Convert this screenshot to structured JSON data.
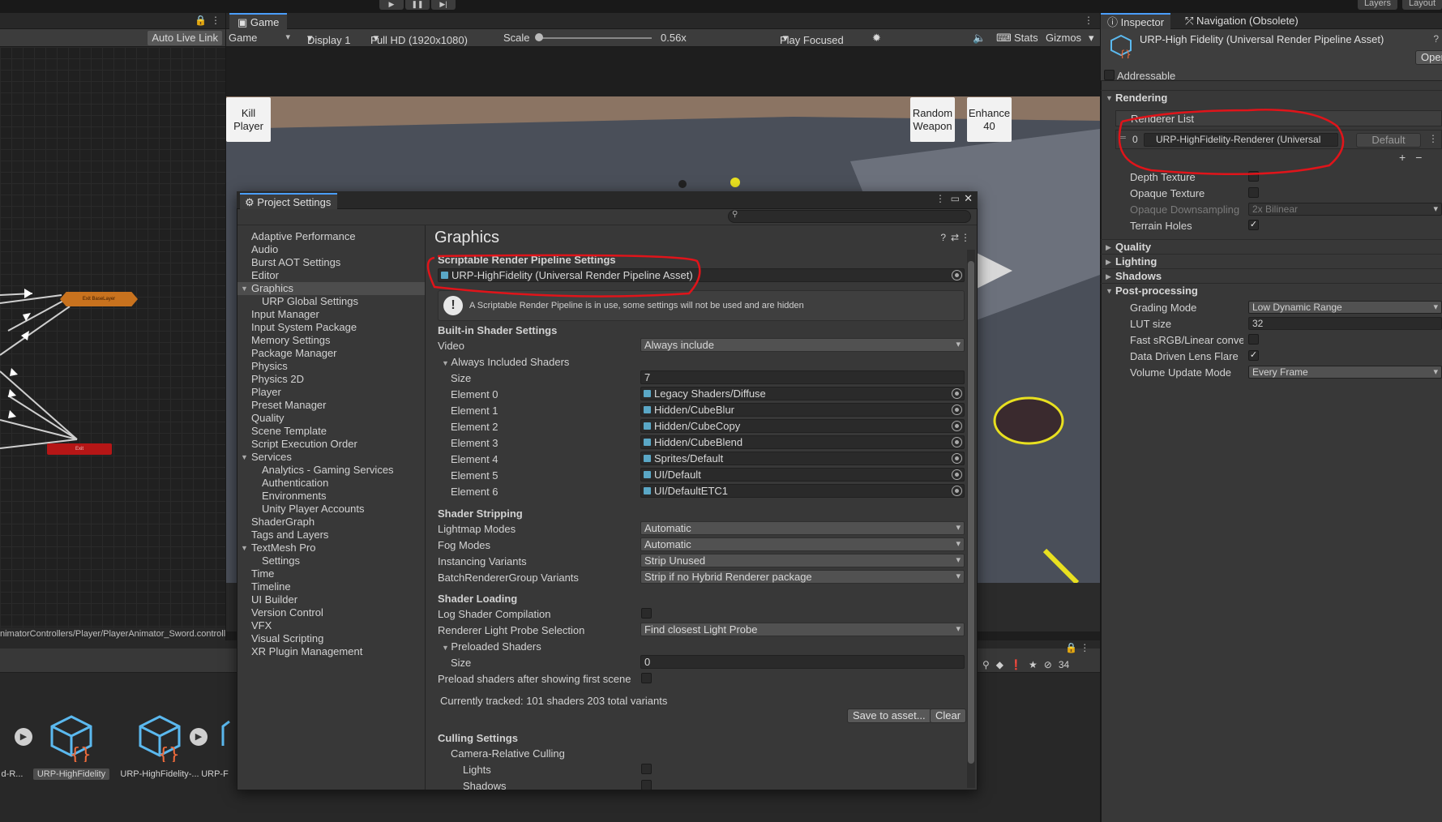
{
  "topbar": {
    "play_icons": [
      "▶",
      "❚❚",
      "▶|"
    ],
    "right": [
      "Layers",
      "Layout"
    ]
  },
  "animator": {
    "auto_live_link": "Auto Live Link",
    "state_base": "Exit BaseLayer",
    "state_exit": "Exit",
    "path": "nimatorControllers/Player/PlayerAnimator_Sword.controller"
  },
  "game": {
    "tab": "Game",
    "view_mode": "Game",
    "display": "Display 1",
    "resolution": "Full HD (1920x1080)",
    "scale_label": "Scale",
    "scale_value": "0.56x",
    "play_focused": "Play Focused",
    "stats": "Stats",
    "gizmos": "Gizmos",
    "btn_kill_player": "Kill Player",
    "btn_random_weapon": "Random Weapon",
    "btn_enhance": "Enhance 40",
    "hidden_count": "34"
  },
  "assets": [
    {
      "label": "d-R..."
    },
    {
      "label": "URP-HighFidelity"
    },
    {
      "label": "URP-HighFidelity-..."
    },
    {
      "label": "URP-F"
    }
  ],
  "inspector": {
    "tab_inspector": "Inspector",
    "tab_navigation": "Navigation (Obsolete)",
    "asset_title": "URP-High Fidelity (Universal Render Pipeline Asset)",
    "open_button": "Open",
    "addressable": "Addressable",
    "rendering": "Rendering",
    "renderer_list": "Renderer List",
    "renderer_index": "0",
    "renderer_value": "URP-HighFidelity-Renderer (Universal",
    "default_button": "Default",
    "depth_texture": "Depth Texture",
    "opaque_texture": "Opaque Texture",
    "opaque_downsampling": "Opaque Downsampling",
    "opaque_downsampling_value": "2x Bilinear",
    "terrain_holes": "Terrain Holes",
    "quality": "Quality",
    "lighting": "Lighting",
    "shadows": "Shadows",
    "post_processing": "Post-processing",
    "grading_mode": "Grading Mode",
    "grading_mode_value": "Low Dynamic Range",
    "lut_size": "LUT size",
    "lut_size_value": "32",
    "fast_srgb": "Fast sRGB/Linear convers",
    "data_driven_lens_flare": "Data Driven Lens Flare",
    "volume_update_mode": "Volume Update Mode",
    "volume_update_mode_value": "Every Frame"
  },
  "project_settings": {
    "window_title": "Project Settings",
    "sidebar": [
      {
        "label": "Adaptive Performance",
        "indent": 0
      },
      {
        "label": "Audio",
        "indent": 0
      },
      {
        "label": "Burst AOT Settings",
        "indent": 0
      },
      {
        "label": "Editor",
        "indent": 0
      },
      {
        "label": "Graphics",
        "indent": 0,
        "selected": true,
        "expanded": true
      },
      {
        "label": "URP Global Settings",
        "indent": 1
      },
      {
        "label": "Input Manager",
        "indent": 0
      },
      {
        "label": "Input System Package",
        "indent": 0
      },
      {
        "label": "Memory Settings",
        "indent": 0
      },
      {
        "label": "Package Manager",
        "indent": 0
      },
      {
        "label": "Physics",
        "indent": 0
      },
      {
        "label": "Physics 2D",
        "indent": 0
      },
      {
        "label": "Player",
        "indent": 0
      },
      {
        "label": "Preset Manager",
        "indent": 0
      },
      {
        "label": "Quality",
        "indent": 0
      },
      {
        "label": "Scene Template",
        "indent": 0
      },
      {
        "label": "Script Execution Order",
        "indent": 0
      },
      {
        "label": "Services",
        "indent": 0,
        "expanded": true
      },
      {
        "label": "Analytics - Gaming Services",
        "indent": 1
      },
      {
        "label": "Authentication",
        "indent": 1
      },
      {
        "label": "Environments",
        "indent": 1
      },
      {
        "label": "Unity Player Accounts",
        "indent": 1
      },
      {
        "label": "ShaderGraph",
        "indent": 0
      },
      {
        "label": "Tags and Layers",
        "indent": 0
      },
      {
        "label": "TextMesh Pro",
        "indent": 0,
        "expanded": true
      },
      {
        "label": "Settings",
        "indent": 1
      },
      {
        "label": "Time",
        "indent": 0
      },
      {
        "label": "Timeline",
        "indent": 0
      },
      {
        "label": "UI Builder",
        "indent": 0
      },
      {
        "label": "Version Control",
        "indent": 0
      },
      {
        "label": "VFX",
        "indent": 0
      },
      {
        "label": "Visual Scripting",
        "indent": 0
      },
      {
        "label": "XR Plugin Management",
        "indent": 0
      }
    ],
    "page_title": "Graphics",
    "srp_header": "Scriptable Render Pipeline Settings",
    "srp_value": "URP-HighFidelity (Universal Render Pipeline Asset)",
    "srp_info": "A Scriptable Render Pipeline is in use, some settings will not be used and are hidden",
    "builtin_header": "Built-in Shader Settings",
    "video_label": "Video",
    "video_value": "Always include",
    "always_included": "Always Included Shaders",
    "size_label": "Size",
    "size_value": "7",
    "elements": [
      {
        "label": "Element 0",
        "value": "Legacy Shaders/Diffuse"
      },
      {
        "label": "Element 1",
        "value": "Hidden/CubeBlur"
      },
      {
        "label": "Element 2",
        "value": "Hidden/CubeCopy"
      },
      {
        "label": "Element 3",
        "value": "Hidden/CubeBlend"
      },
      {
        "label": "Element 4",
        "value": "Sprites/Default"
      },
      {
        "label": "Element 5",
        "value": "UI/Default"
      },
      {
        "label": "Element 6",
        "value": "UI/DefaultETC1"
      }
    ],
    "stripping_header": "Shader Stripping",
    "lightmap_modes": "Lightmap Modes",
    "lightmap_modes_value": "Automatic",
    "fog_modes": "Fog Modes",
    "fog_modes_value": "Automatic",
    "instancing_variants": "Instancing Variants",
    "instancing_variants_value": "Strip Unused",
    "brg_variants": "BatchRendererGroup Variants",
    "brg_variants_value": "Strip if no Hybrid Renderer package",
    "loading_header": "Shader Loading",
    "log_shader_compilation": "Log Shader Compilation",
    "probe_selection": "Renderer Light Probe Selection",
    "probe_selection_value": "Find closest Light Probe",
    "preloaded_shaders": "Preloaded Shaders",
    "preloaded_size_label": "Size",
    "preloaded_size_value": "0",
    "preload_after": "Preload shaders after showing first scene",
    "tracked": "Currently tracked: 101 shaders 203 total variants",
    "save_to_asset": "Save to asset...",
    "clear": "Clear",
    "culling_header": "Culling Settings",
    "camera_relative": "Camera-Relative Culling",
    "lights": "Lights",
    "shadows": "Shadows"
  },
  "colors": {
    "annotation": "#e0141a",
    "accent": "#4a9eff"
  }
}
